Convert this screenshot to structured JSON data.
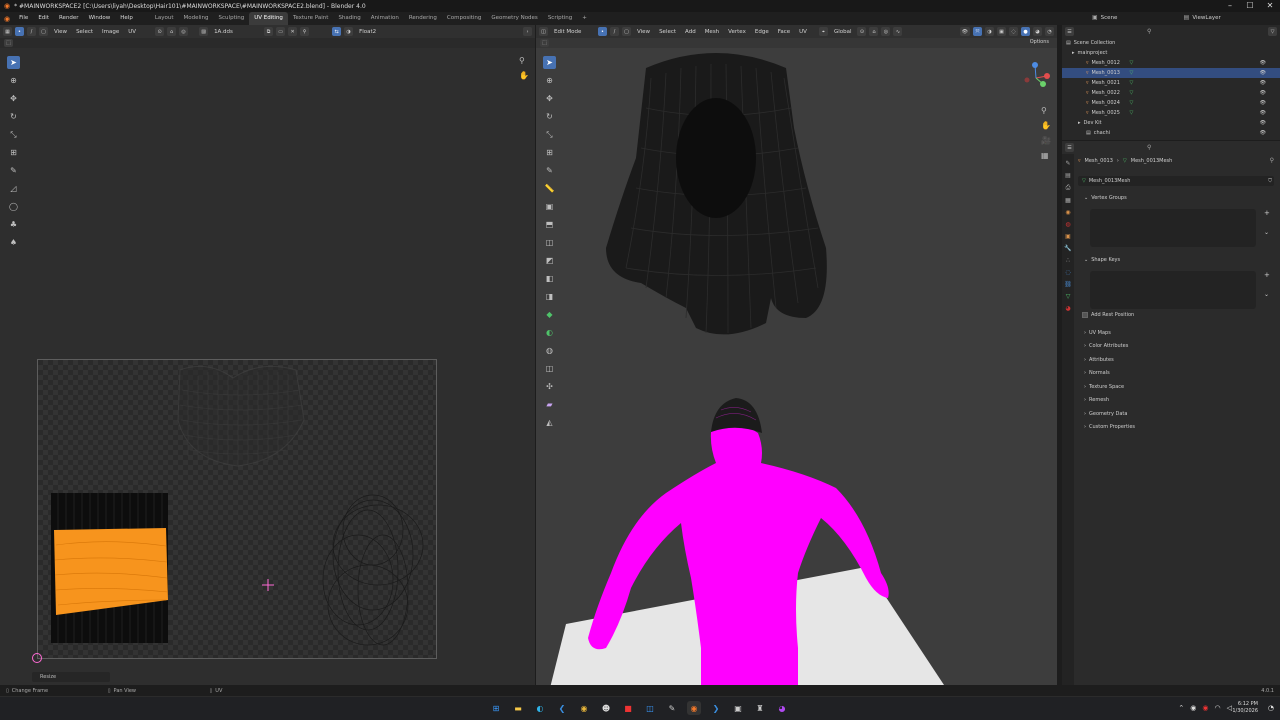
{
  "window": {
    "title": "* #MAINWORKSPACE2 [C:\\Users\\liyah\\Desktop\\Hair101\\#MAINWORKSPACE\\#MAINWORKSPACE2.blend] - Blender 4.0"
  },
  "menu": {
    "items": [
      "File",
      "Edit",
      "Render",
      "Window",
      "Help"
    ]
  },
  "workspaces": [
    "Layout",
    "Modeling",
    "Sculpting",
    "UV Editing",
    "Texture Paint",
    "Shading",
    "Animation",
    "Rendering",
    "Compositing",
    "Geometry Nodes",
    "Scripting"
  ],
  "active_workspace": "UV Editing",
  "scene": {
    "name": "Scene",
    "view_layer": "ViewLayer"
  },
  "uv_editor": {
    "header_menus": [
      "View",
      "Select",
      "Image",
      "UV"
    ],
    "image_name": "1A.dds",
    "color_space": "Float2",
    "last_op": "Resize"
  },
  "viewport": {
    "mode": "Edit Mode",
    "header_menus": [
      "View",
      "Select",
      "Add",
      "Mesh",
      "Vertex",
      "Edge",
      "Face",
      "UV"
    ],
    "orientation": "Global",
    "options_label": "Options"
  },
  "outliner": {
    "root": "Scene Collection",
    "items": [
      {
        "label": "mainproject",
        "selected": false
      },
      {
        "label": "Mesh_0012",
        "selected": false
      },
      {
        "label": "Mesh_0013",
        "selected": true
      },
      {
        "label": "Mesh_0021",
        "selected": false
      },
      {
        "label": "Mesh_0022",
        "selected": false
      },
      {
        "label": "Mesh_0024",
        "selected": false
      },
      {
        "label": "Mesh_0025",
        "selected": false
      },
      {
        "label": "Dev Kit",
        "selected": false
      },
      {
        "label": "chachi",
        "selected": false
      }
    ]
  },
  "properties": {
    "breadcrumb_object": "Mesh_0013",
    "breadcrumb_data": "Mesh_0013Mesh",
    "datablock": "Mesh_0013Mesh",
    "vertex_groups": "Vertex Groups",
    "shape_keys": "Shape Keys",
    "add_rest_position": "Add Rest Position",
    "sections": [
      "UV Maps",
      "Color Attributes",
      "Attributes",
      "Normals",
      "Texture Space",
      "Remesh",
      "Geometry Data",
      "Custom Properties"
    ]
  },
  "status": {
    "left": "Change Frame",
    "middle": "Pan View",
    "right_uv": "UV",
    "version": "4.0.1"
  },
  "clock": {
    "time": "6:12 PM",
    "date": "1/30/2026"
  },
  "colors": {
    "accent": "#4772b3",
    "magenta": "#ff00ff",
    "orange": "#f7941d",
    "selected_row": "#334d80"
  }
}
